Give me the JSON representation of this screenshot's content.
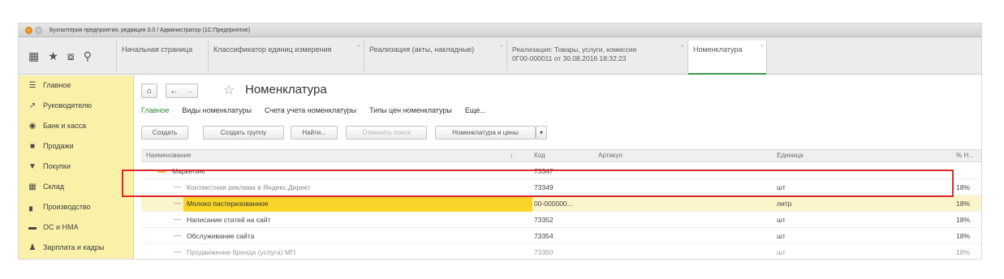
{
  "window": {
    "title": "Бухгалтерия предприятия, редакция 3.0 / Администратор (1С:Предприятие)"
  },
  "toolbar_icons": [
    "grid-icon",
    "star-icon",
    "history-icon",
    "search-icon"
  ],
  "tabs": [
    {
      "label": "Начальная страница",
      "closable": false
    },
    {
      "label": "Классификатор единиц измерения",
      "closable": true
    },
    {
      "label": "Реализация (акты, накладные)",
      "closable": true
    },
    {
      "label": "Реализация: Товары, услуги, комиссия",
      "label2": "0Г00-000011 от 30.08.2016 18:32:23",
      "closable": true
    },
    {
      "label": "Номенклатура",
      "closable": true,
      "active": true
    }
  ],
  "sidebar": {
    "items": [
      {
        "label": "Главное",
        "icon": "menu-icon"
      },
      {
        "label": "Руководителю",
        "icon": "chart-icon"
      },
      {
        "label": "Банк и касса",
        "icon": "coins-icon"
      },
      {
        "label": "Продажи",
        "icon": "bag-icon"
      },
      {
        "label": "Покупки",
        "icon": "cart-icon"
      },
      {
        "label": "Склад",
        "icon": "warehouse-icon"
      },
      {
        "label": "Производство",
        "icon": "factory-icon"
      },
      {
        "label": "ОС и НМА",
        "icon": "car-icon"
      },
      {
        "label": "Зарплата и кадры",
        "icon": "person-icon"
      }
    ]
  },
  "page": {
    "title": "Номенклатура",
    "subnav": [
      "Главное",
      "Виды номенклатуры",
      "Счета учета номенклатуры",
      "Типы цен номенклатуры",
      "Еще..."
    ],
    "commands": {
      "create": "Создать",
      "create_group": "Создать группу",
      "find": "Найти...",
      "cancel_search": "Отменить поиск",
      "nomenclature_prices": "Номенклатура и цены"
    }
  },
  "table": {
    "columns": [
      "Наименование",
      "Код",
      "Артикул",
      "Единица",
      "% Н..."
    ],
    "sort_indicator": "↓",
    "rows": [
      {
        "name": "Маркетинг",
        "code": "73347",
        "article": "",
        "unit": "",
        "vat": "",
        "type": "group"
      },
      {
        "name": "Контекстная реклама в Яндекс.Директ",
        "code": "73349",
        "article": "",
        "unit": "шт",
        "vat": "18%",
        "type": "item"
      },
      {
        "name": "Молоко пастеризованное",
        "code": "00-000000...",
        "article": "",
        "unit": "литр",
        "vat": "18%",
        "type": "item",
        "selected": true
      },
      {
        "name": "Написание статей на сайт",
        "code": "73352",
        "article": "",
        "unit": "шт",
        "vat": "18%",
        "type": "item"
      },
      {
        "name": "Обслуживание сайта",
        "code": "73354",
        "article": "",
        "unit": "шт",
        "vat": "18%",
        "type": "item"
      },
      {
        "name": "Продвижение бренда (услуга) МП",
        "code": "73350",
        "article": "",
        "unit": "шт",
        "vat": "18%",
        "type": "item"
      }
    ]
  },
  "colors": {
    "sidebar_bg": "#fbf0a8",
    "accent_green": "#2f8a3c",
    "selection_yellow": "#f7d529",
    "annotation_red": "#e0262a"
  }
}
